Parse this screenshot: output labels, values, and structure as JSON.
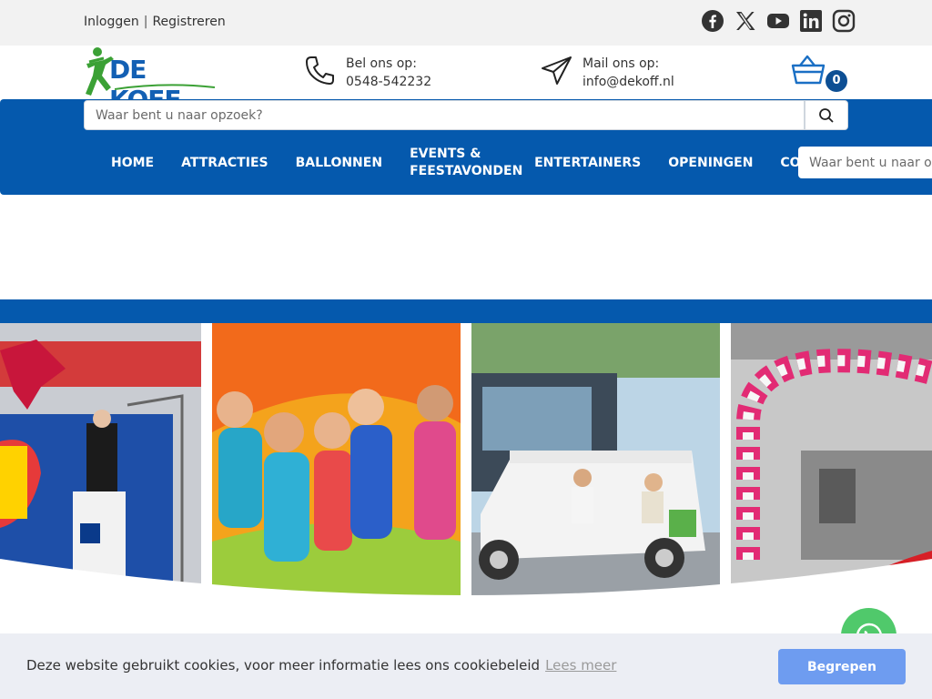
{
  "topbar": {
    "login": "Inloggen",
    "separator": "|",
    "register": "Registreren",
    "social": [
      "facebook-icon",
      "x-icon",
      "youtube-icon",
      "linkedin-icon",
      "instagram-icon"
    ]
  },
  "header": {
    "logo_text": "DE KOFF",
    "phone": {
      "label": "Bel ons op:",
      "value": "0548-542232"
    },
    "mail": {
      "label": "Mail ons op:",
      "value": "info@dekoff.nl"
    },
    "cart_count": "0"
  },
  "search": {
    "placeholder": "Waar bent u naar opzoek?"
  },
  "nav": {
    "items": [
      "HOME",
      "ATTRACTIES",
      "BALLONNEN",
      "EVENTS & FEESTAVONDEN",
      "ENTERTAINERS",
      "OPENINGEN",
      "CONTACT"
    ],
    "search_placeholder": "Waar bent u naar opzoek?"
  },
  "cookie": {
    "message": "Deze website gebruikt cookies, voor meer informatie lees ons cookiebeleid",
    "link": "Lees meer",
    "button": "Begrepen"
  },
  "colors": {
    "brand_blue": "#0559ad",
    "dark_blue": "#0d4f94",
    "logo_green": "#3ba135",
    "button_blue": "#6e9cf0",
    "whatsapp": "#3ec45b"
  }
}
